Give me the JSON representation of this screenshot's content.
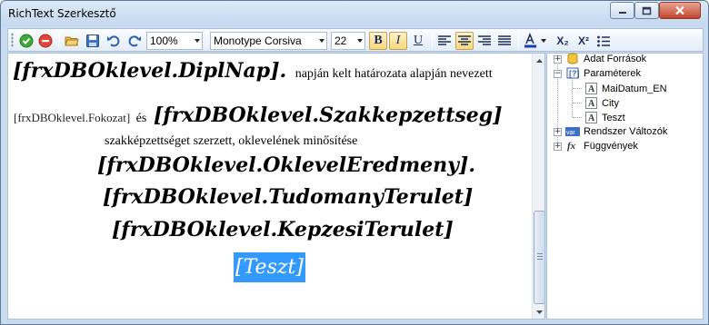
{
  "window": {
    "title": "RichText Szerkesztő"
  },
  "toolbar": {
    "zoom": "100%",
    "font_family": "Monotype Corsiva",
    "font_size": "22",
    "bold_label": "B",
    "italic_label": "I",
    "underline_label": "U",
    "subscript_label": "X₂",
    "superscript_label": "X²"
  },
  "editor": {
    "line1_field": "[frxDBOklevel.DiplNap].",
    "line1_text": "napján kelt határozata alapján nevezett",
    "line2_field_small": "[frxDBOklevel.Fokozat]",
    "line2_conj": "és",
    "line2_field": "[frxDBOklevel.Szakkepzettseg]",
    "line3_text": "szakképzettséget szerzett, oklevelének minősítése",
    "line4_field": "[frxDBOklevel.OklevelEredmeny].",
    "line5_field": "[frxDBOklevel.TudomanyTerulet]",
    "line6_field": "[frxDBOklevel.KepzesiTerulet]",
    "line7_selected": "[Teszt]"
  },
  "tree": {
    "data_sources": "Adat Források",
    "parameters": "Paraméterek",
    "params": [
      "MaiDatum_EN",
      "City",
      "Teszt"
    ],
    "system_vars": "Rendszer Változók",
    "functions": "Függvények"
  },
  "colors": {
    "selection": "#3399ff",
    "window_frame": "#c9dbee",
    "toolbar_active": "#f7d780"
  }
}
